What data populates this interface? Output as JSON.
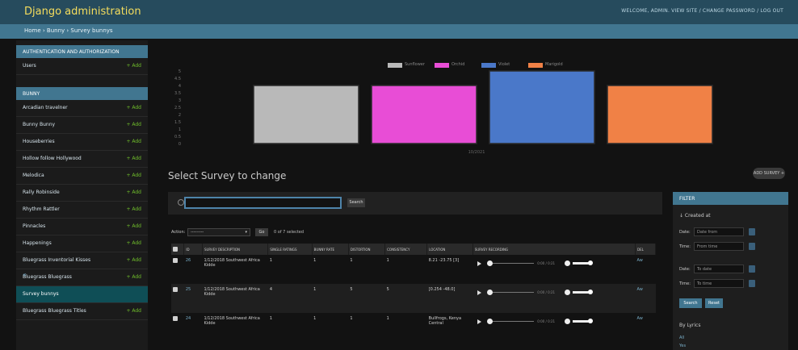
{
  "header": {
    "brand": "Django administration",
    "user_tools": "WELCOME, ADMIN. VIEW SITE / CHANGE PASSWORD / LOG OUT"
  },
  "breadcrumbs": "Home › Bunny › Survey bunnys",
  "sidebar": {
    "modules": [
      {
        "caption": "AUTHENTICATION AND AUTHORIZATION",
        "items": [
          {
            "label": "Users",
            "add": "+ Add"
          }
        ]
      },
      {
        "caption": "BUNNY",
        "items": [
          {
            "label": "Arcadian travelner",
            "add": "+ Add"
          },
          {
            "label": "Bunny Bunny",
            "add": "+ Add"
          },
          {
            "label": "Houseberries",
            "add": "+ Add"
          },
          {
            "label": "Hollow follow Hollywood",
            "add": "+ Add"
          },
          {
            "label": "Melodica",
            "add": "+ Add"
          },
          {
            "label": "Rally Robinside",
            "add": "+ Add"
          },
          {
            "label": "Rhythm Rattler",
            "add": "+ Add"
          },
          {
            "label": "Pinnacles",
            "add": "+ Add"
          },
          {
            "label": "Happenings",
            "add": "+ Add"
          },
          {
            "label": "Bluegrass Inventorial Kisses",
            "add": "+ Add"
          },
          {
            "label": "Bluegrass Bluegrass",
            "add": "+ Add"
          },
          {
            "label": "Survey bunnys",
            "add": ""
          },
          {
            "label": "Bluegrass Bluegrass Titles",
            "add": "+ Add"
          }
        ]
      }
    ],
    "collapse_icon": "double-chevron-left-icon"
  },
  "chart_data": {
    "type": "bar",
    "categories": [
      "Survey bunnys"
    ],
    "series": [
      {
        "name": "Sunflower",
        "color": "#b9b9b9",
        "values": [
          4
        ]
      },
      {
        "name": "Orchid",
        "color": "#e84dd6",
        "values": [
          4
        ]
      },
      {
        "name": "Violet",
        "color": "#4a78c9",
        "values": [
          5
        ]
      },
      {
        "name": "Marigold",
        "color": "#f08146",
        "values": [
          4
        ]
      }
    ],
    "ylim": [
      0,
      5
    ],
    "yticks": [
      "5",
      "4.5",
      "4",
      "3.5",
      "3",
      "2.5",
      "2",
      "1.5",
      "1",
      "0.5",
      "0"
    ],
    "xlabel": "",
    "ylabel": "",
    "category_label": "10/2021",
    "legend_position": "top-center",
    "grid": false
  },
  "page": {
    "title": "Select Survey to change",
    "add_button": "ADD SURVEY +"
  },
  "search": {
    "value": "",
    "placeholder": "",
    "button": "Search"
  },
  "actions": {
    "label": "Action:",
    "selected": "---------",
    "go": "Go",
    "count": "0 of 7 selected"
  },
  "table": {
    "columns": [
      "ID",
      "SURVEY DESCRIPTION",
      "SINGLE RATINGS",
      "BUNNY RATE",
      "DISTORTION",
      "CONSISTENCY",
      "LOCATION",
      "SURVEY RECORDING",
      "DEL"
    ],
    "rows": [
      {
        "id": "26",
        "desc": "1/12/2018 Southwest Africa Kidde",
        "c1": "1",
        "c2": "1",
        "c3": "1",
        "c4": "1",
        "location": "8.21 -23.75 [3]",
        "time": "0:00 / 0:21",
        "del": "Aw"
      },
      {
        "id": "25",
        "desc": "1/12/2018 Southwest Africa Kidde",
        "c1": "4",
        "c2": "1",
        "c3": "5",
        "c4": "5",
        "location": "[0.254 -48.0]",
        "time": "0:00 / 0:21",
        "del": "Aw"
      },
      {
        "id": "24",
        "desc": "1/12/2018 Southwest Africa Kidde",
        "c1": "1",
        "c2": "1",
        "c3": "1",
        "c4": "1",
        "location": "Bullfrogs, Kenya Central",
        "time": "0:00 / 0:21",
        "del": "Aw"
      }
    ]
  },
  "filter": {
    "caption": "FILTER",
    "subtitle": "↓ Created at",
    "rows": [
      {
        "label": "Date:",
        "value": "Date from"
      },
      {
        "label": "Time:",
        "value": "From time"
      },
      {
        "label": "Date:",
        "value": "To date"
      },
      {
        "label": "Time:",
        "value": "To time"
      }
    ],
    "search_button": "Search",
    "reset_button": "Reset",
    "section": "By Lyrics",
    "links": [
      "All",
      "Yes"
    ]
  }
}
